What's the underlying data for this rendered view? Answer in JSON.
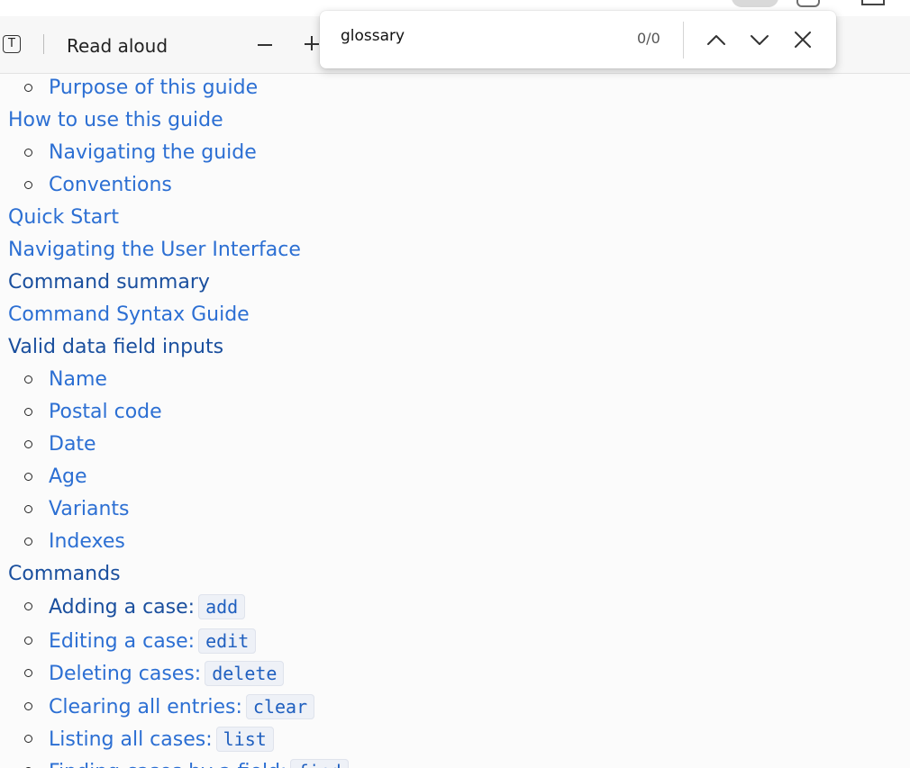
{
  "reader_toolbar": {
    "read_aloud_label": "Read aloud"
  },
  "find_bar": {
    "query": "glossary",
    "match_count": "0/0"
  },
  "toc": {
    "items": [
      {
        "label": "Purpose of this guide",
        "level": 2,
        "visited": false
      },
      {
        "label": "How to use this guide",
        "level": 1,
        "visited": false
      },
      {
        "label": "Navigating the guide",
        "level": 2,
        "visited": false
      },
      {
        "label": "Conventions",
        "level": 2,
        "visited": false
      },
      {
        "label": "Quick Start",
        "level": 1,
        "visited": false
      },
      {
        "label": "Navigating the User Interface",
        "level": 1,
        "visited": false
      },
      {
        "label": "Command summary",
        "level": 1,
        "visited": true
      },
      {
        "label": "Command Syntax Guide",
        "level": 1,
        "visited": false
      },
      {
        "label": "Valid data field inputs",
        "level": 1,
        "visited": true
      },
      {
        "label": "Name",
        "level": 2,
        "visited": false
      },
      {
        "label": "Postal code",
        "level": 2,
        "visited": false
      },
      {
        "label": "Date",
        "level": 2,
        "visited": false
      },
      {
        "label": "Age",
        "level": 2,
        "visited": false
      },
      {
        "label": "Variants",
        "level": 2,
        "visited": false
      },
      {
        "label": "Indexes",
        "level": 2,
        "visited": false
      },
      {
        "label": "Commands",
        "level": 1,
        "visited": true
      },
      {
        "label": "Adding a case:",
        "code": "add",
        "level": 2,
        "visited": true
      },
      {
        "label": "Editing a case:",
        "code": "edit",
        "level": 2,
        "visited": false
      },
      {
        "label": "Deleting cases:",
        "code": "delete",
        "level": 2,
        "visited": false
      },
      {
        "label": "Clearing all entries:",
        "code": "clear",
        "level": 2,
        "visited": false
      },
      {
        "label": "Listing all cases:",
        "code": "list",
        "level": 2,
        "visited": false
      },
      {
        "label": "Finding cases by a field:",
        "code": "find",
        "level": 2,
        "visited": false
      }
    ]
  },
  "colors": {
    "link": "#2c6fd3",
    "visited_link": "#1a4f9e",
    "page_background": "#fbfbfb"
  }
}
